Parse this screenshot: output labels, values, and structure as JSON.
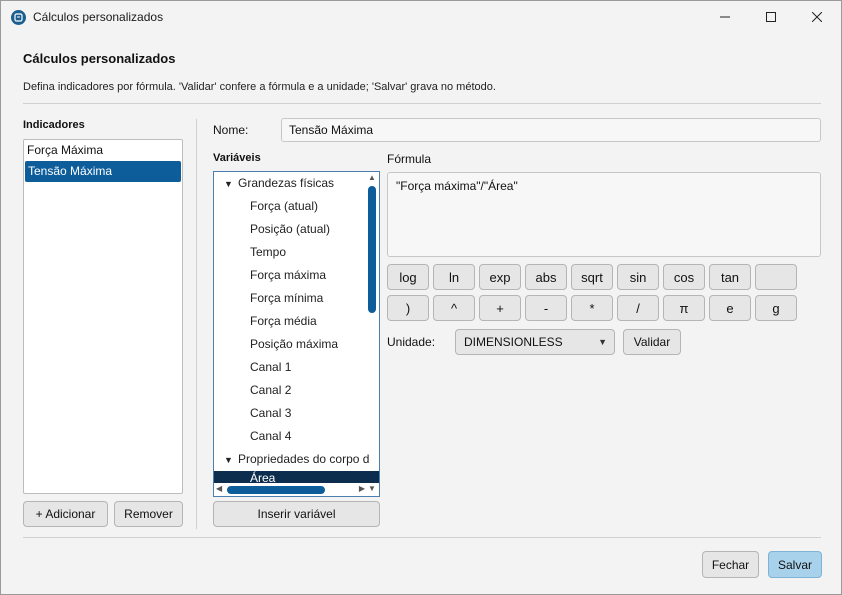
{
  "window": {
    "title": "Cálculos personalizados",
    "controls": {
      "minimize": "—",
      "maximize": "☐",
      "close": "✕"
    }
  },
  "header": {
    "heading": "Cálculos personalizados",
    "description": "Defina indicadores por fórmula. 'Validar' confere a fórmula e a unidade; 'Salvar' grava no método."
  },
  "indicators": {
    "label": "Indicadores",
    "items": [
      {
        "label": "Força Máxima",
        "selected": false
      },
      {
        "label": "Tensão Máxima",
        "selected": true
      }
    ],
    "add_label": "+ Adicionar",
    "remove_label": "Remover"
  },
  "name": {
    "label": "Nome:",
    "value": "Tensão Máxima"
  },
  "variables": {
    "label": "Variáveis",
    "groups": [
      {
        "label": "Grandezas físicas",
        "items": [
          "Força (atual)",
          "Posição (atual)",
          "Tempo",
          "Força máxima",
          "Força mínima",
          "Força média",
          "Posição máxima",
          "Canal 1",
          "Canal 2",
          "Canal 3",
          "Canal 4"
        ]
      },
      {
        "label": "Propriedades do corpo d",
        "items": [
          "Área"
        ]
      }
    ],
    "insert_label": "Inserir variável"
  },
  "formula": {
    "label": "Fórmula",
    "value": "\"Força máxima\"/\"Área\""
  },
  "operators": {
    "row1": [
      "log",
      "ln",
      "exp",
      "abs",
      "sqrt",
      "sin",
      "cos",
      "tan",
      ""
    ],
    "row2": [
      ")",
      "^",
      "+",
      "-",
      "*",
      "/",
      "π",
      "e",
      "g"
    ]
  },
  "unit": {
    "label": "Unidade:",
    "value": "DIMENSIONLESS",
    "validate_label": "Validar"
  },
  "footer": {
    "close_label": "Fechar",
    "save_label": "Salvar"
  },
  "colors": {
    "accent": "#0d5d9b",
    "primary_button": "#a8d2ec",
    "background": "#f3f3f3"
  }
}
